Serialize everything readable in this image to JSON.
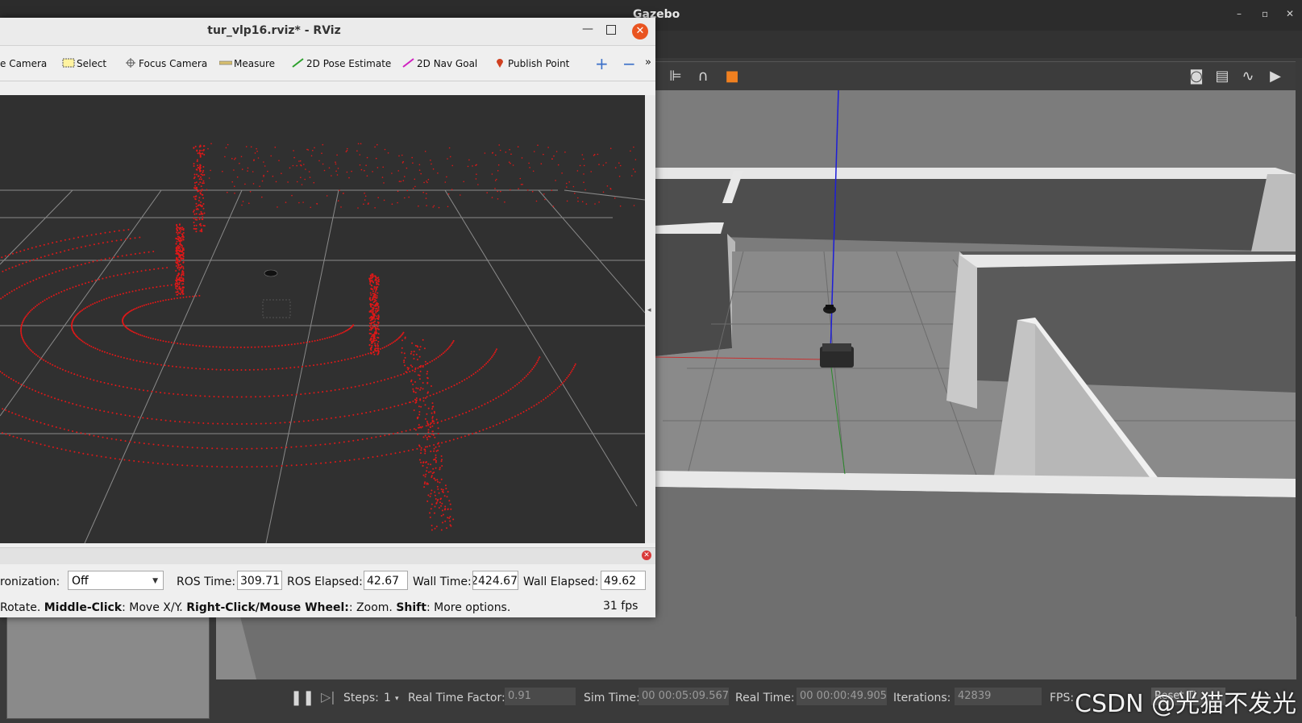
{
  "gazebo": {
    "window_title": "Gazebo",
    "window_controls": {
      "minimize": "–",
      "maximize": "▫",
      "close": "✕"
    },
    "statusbar": {
      "pause_icon": "pause-icon",
      "step_icon": "step-icon",
      "steps_label": "Steps:",
      "steps_value": "1",
      "real_time_factor_label": "Real Time Factor:",
      "real_time_factor_value": "0.91",
      "sim_time_label": "Sim Time:",
      "sim_time_value": "00 00:05:09.567",
      "real_time_label": "Real Time:",
      "real_time_value": "00 00:00:49.905",
      "iterations_label": "Iterations:",
      "iterations_value": "42839",
      "fps_label": "FPS:",
      "reset_label": "Reset Ti"
    }
  },
  "watermark": "CSDN @光猫不发光",
  "rviz": {
    "window_title": "tur_vlp16.rviz* - RViz",
    "toolbar": {
      "items": [
        {
          "label": "e Camera",
          "icon": "move-camera-icon"
        },
        {
          "label": "Select",
          "icon": "select-icon"
        },
        {
          "label": "Focus Camera",
          "icon": "focus-camera-icon"
        },
        {
          "label": "Measure",
          "icon": "measure-icon"
        },
        {
          "label": "2D Pose Estimate",
          "icon": "pose-estimate-icon"
        },
        {
          "label": "2D Nav Goal",
          "icon": "nav-goal-icon"
        },
        {
          "label": "Publish Point",
          "icon": "publish-point-icon"
        }
      ],
      "add_icon": "plus-icon",
      "remove_icon": "minus-icon",
      "overflow_icon": "chevron-right-icon"
    },
    "time_panel": {
      "sync_label": "ronization:",
      "sync_value": "Off",
      "ros_time_label": "ROS Time:",
      "ros_time_value": "309.71",
      "ros_elapsed_label": "ROS Elapsed:",
      "ros_elapsed_value": "42.67",
      "wall_time_label": "Wall Time:",
      "wall_time_value": "2424.67",
      "wall_elapsed_label": "Wall Elapsed:",
      "wall_elapsed_value": "49.62"
    },
    "status": {
      "rotate": "Rotate. ",
      "middle_click": "Middle-Click",
      "middle_click_text": ": Move X/Y. ",
      "right_click": "Right-Click/Mouse Wheel:",
      "right_click_text": ": Zoom. ",
      "shift": "Shift",
      "shift_text": ": More options."
    },
    "fps": "31 fps",
    "point_color": "#e01818"
  }
}
